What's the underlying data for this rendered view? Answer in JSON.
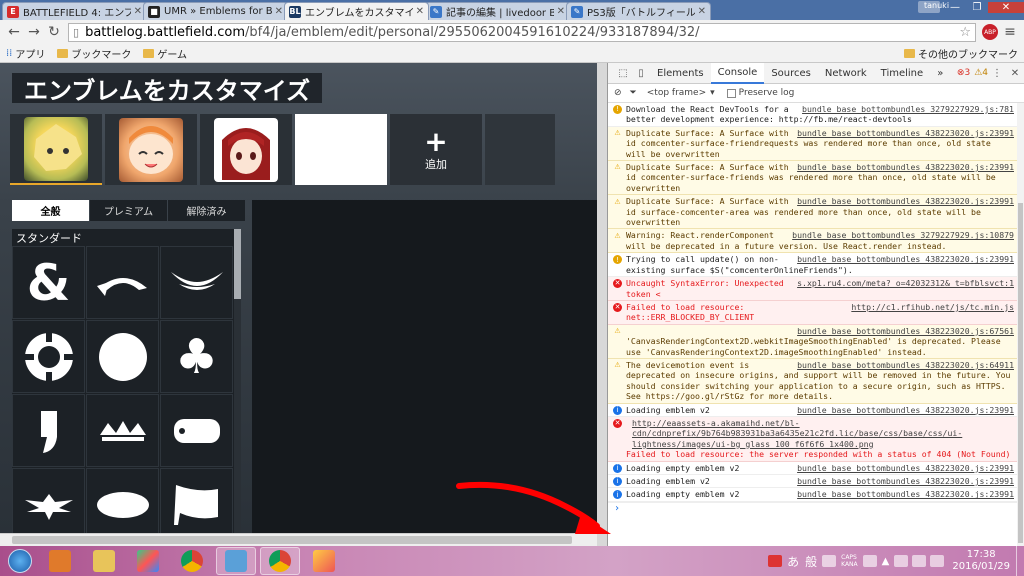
{
  "browser": {
    "tabs": [
      {
        "icon_text": "E",
        "icon_color": "#d62c2c",
        "title": "BATTLEFIELD 4: エンブ"
      },
      {
        "icon_text": "■",
        "icon_color": "#222222",
        "title": "UMR » Emblems for Ba"
      },
      {
        "icon_text": "BL",
        "icon_color": "#1c3a63",
        "title": "エンブレムをカスタマイズ"
      },
      {
        "icon_text": "✎",
        "icon_color": "#3a77c8",
        "title": "記事の編集 | livedoor Bl"
      },
      {
        "icon_text": "✎",
        "icon_color": "#3a77c8",
        "title": "PS3版「バトルフィールド"
      }
    ],
    "user_label": "tanuki",
    "url_domain": "battlelog.battlefield.com",
    "url_path": "/bf4/ja/emblem/edit/personal/2955062004591610224/933187894/32/",
    "bookmarks": {
      "apps": "アプリ",
      "bookmarks": "ブックマーク",
      "games": "ゲーム",
      "other": "その他のブックマーク"
    },
    "abp_label": "ABP"
  },
  "page": {
    "title": "エンブレムをカスタマイズ",
    "add_label": "追加",
    "tabs": [
      "全般",
      "プレミアム",
      "解除済み"
    ],
    "category": "スタンダード"
  },
  "devtools": {
    "tabs": [
      "Elements",
      "Console",
      "Sources",
      "Network",
      "Timeline"
    ],
    "more": "»",
    "error_count": "3",
    "warning_count": "4",
    "frame": "<top frame>",
    "preserve_log": "Preserve log",
    "messages": [
      {
        "level": "log",
        "text": "Download the React DevTools for a better development experience: http://fb.me/react-devtools",
        "src": "bundle base bottombundles 3279227929.js:781"
      },
      {
        "level": "warn",
        "text": "Duplicate Surface: A Surface with id comcenter-surface-friendrequests was rendered more than once, old state will be overwritten",
        "src": "bundle base bottombundles 438223020.js:23991"
      },
      {
        "level": "warn",
        "text": "Duplicate Surface: A Surface with id comcenter-surface-friends was rendered more than once, old state will be overwritten",
        "src": "bundle base bottombundles 438223020.js:23991"
      },
      {
        "level": "warn",
        "text": "Duplicate Surface: A Surface with id surface-comcenter-area was rendered more than once, old state will be overwritten",
        "src": "bundle base bottombundles 438223020.js:23991"
      },
      {
        "level": "warn",
        "text": "Warning: React.renderComponent will be deprecated in a future version. Use React.render instead.",
        "src": "bundle base bottombundles 3279227929.js:10879"
      },
      {
        "level": "log",
        "text": "Trying to call update() on non-existing surface $S(\"comcenterOnlineFriends\").",
        "src": "bundle base bottombundles 438223020.js:23991"
      },
      {
        "level": "error",
        "text": "Uncaught SyntaxError: Unexpected token <",
        "src": "s.xp1.ru4.com/meta? o=42032312& t=bfblsvct:1"
      },
      {
        "level": "error",
        "text": "Failed to load resource: net::ERR_BLOCKED_BY_CLIENT",
        "src": "http://c1.rfihub.net/js/tc.min.js"
      },
      {
        "level": "warn",
        "text": "'CanvasRenderingContext2D.webkitImageSmoothingEnabled' is deprecated. Please use 'CanvasRenderingContext2D.imageSmoothingEnabled' instead.",
        "src": "bundle base bottombundles 438223020.js:67561"
      },
      {
        "level": "warn",
        "text": "The devicemotion event is deprecated on insecure origins, and support will be removed in the future. You should consider switching your application to a secure origin, such as HTTPS. See https://goo.gl/rStGz for more details.",
        "src": "bundle base bottombundles 438223020.js:64911"
      },
      {
        "level": "info",
        "text": "Loading emblem v2",
        "src": "bundle base bottombundles 438223020.js:23991"
      },
      {
        "level": "error",
        "text": "Failed to load resource: the server responded with a status of 404 (Not Found)",
        "src": "http://eaassets-a.akamaihd.net/bl-cdn/cdnprefix/9b764b983931ba3a6435e21c2fd.lic/base/css/base/css/ui-lightness/images/ui-bg_glass_100_f6f6f6_1x400.png"
      },
      {
        "level": "info",
        "text": "Loading empty emblem v2",
        "src": "bundle base bottombundles 438223020.js:23991"
      },
      {
        "level": "info",
        "text": "Loading emblem v2",
        "src": "bundle base bottombundles 438223020.js:23991"
      },
      {
        "level": "info",
        "text": "Loading empty emblem v2",
        "src": "bundle base bottombundles 438223020.js:23991"
      }
    ]
  },
  "taskbar": {
    "ime_a": "あ",
    "ime_mode": "般",
    "caps": "CAPS",
    "kana": "KANA",
    "time": "17:38",
    "date": "2016/01/29"
  },
  "colors": {
    "accent_red": "#e5191c",
    "warning_bg": "#fffbe6",
    "arrow": "#ff0000"
  }
}
